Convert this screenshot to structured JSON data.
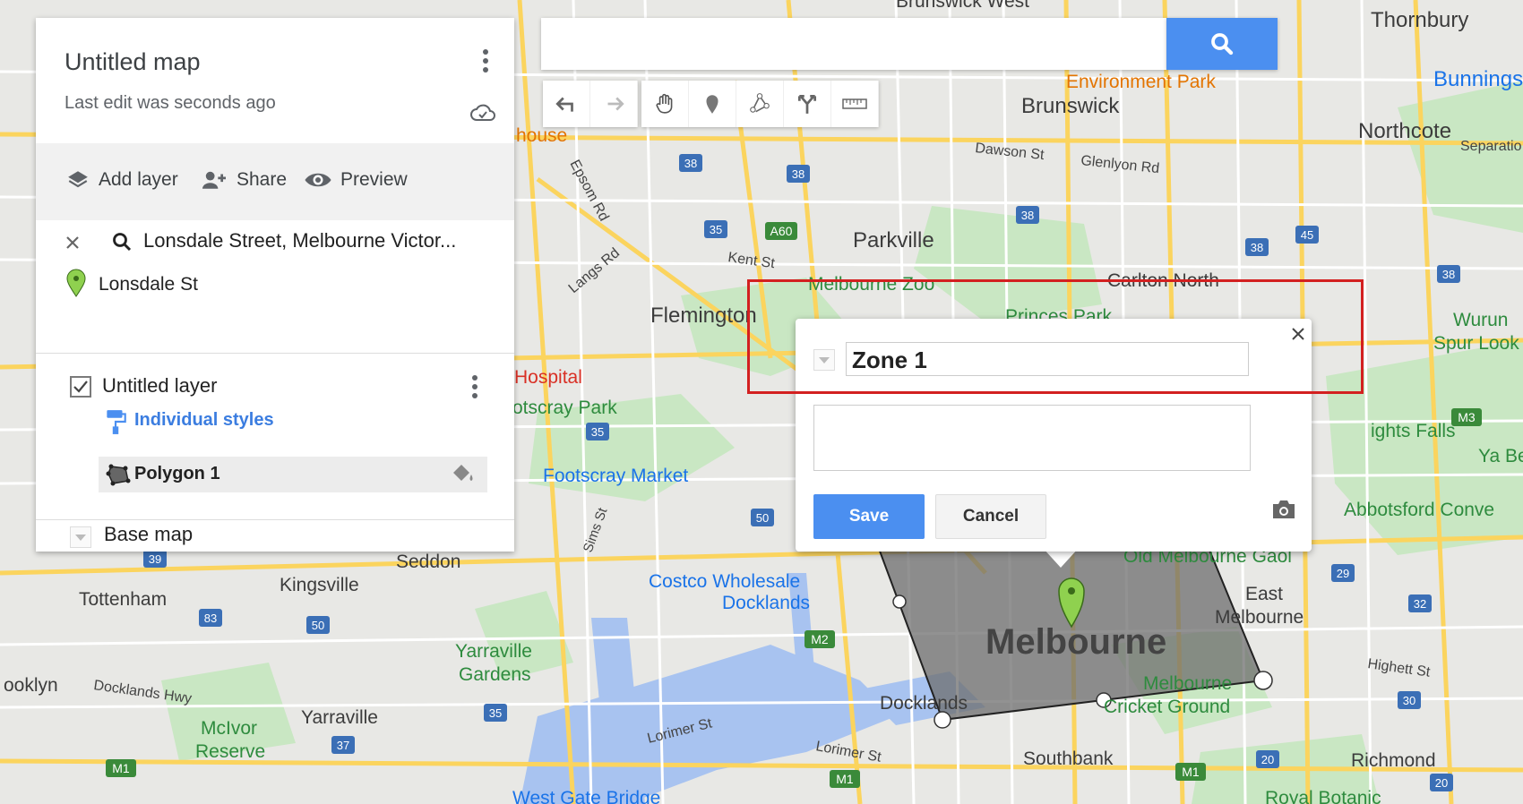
{
  "map_labels": {
    "brunswick_west": "Brunswick West",
    "thornbury": "Thornbury",
    "bunnings": "Bunnings",
    "environment_park": "Environment Park",
    "brunswick": "Brunswick",
    "northcote": "Northcote",
    "separation": "Separatio",
    "dawson_st": "Dawson St",
    "glenlyon_rd": "Glenlyon Rd",
    "house": "house",
    "epsom_rd": "Epsom Rd",
    "parkville": "Parkville",
    "kent_st": "Kent St",
    "a60": "A60",
    "carlton_north": "Carlton North",
    "melbourne_zoo": "Melbourne Zoo",
    "langs_rd": "Langs Rd",
    "flemington": "Flemington",
    "princes_park": "Princes Park",
    "wurundjeri": "Wurun",
    "spur_lookout": "Spur Look",
    "hospital": "Hospital",
    "footscray_park": "otscray Park",
    "heights_falls": "ights Falls",
    "m3": "M3",
    "footscray_market": "Footscray Market",
    "yarra_bend": "Ya Bend",
    "abbotsford": "Abbotsford Conve",
    "sims_st": "Sims St",
    "seddon": "Seddon",
    "kingsville": "Kingsville",
    "tottenham": "Tottenham",
    "costco": "Costco Wholesale",
    "docklands_costco": "Docklands",
    "old_melbourne_gaol": "Old Melbourne Gaol",
    "east_melbourne_1": "East",
    "east_melbourne_2": "Melbourne",
    "melbourne": "Melbourne",
    "m2": "M2",
    "brooklyn": "ooklyn",
    "docklands_hwy": "Docklands Hwy",
    "yarraville_gardens_1": "Yarraville",
    "yarraville_gardens_2": "Gardens",
    "highett_st": "Highett St",
    "mcg_1": "Melbourne",
    "mcg_2": "Cricket Ground",
    "docklands": "Docklands",
    "mcivor_1": "McIvor",
    "mcivor_2": "Reserve",
    "yarraville": "Yarraville",
    "lorimer_st": "Lorimer St",
    "lorimer_st2": "Lorimer St",
    "southbank": "Southbank",
    "richmond": "Richmond",
    "west_gate_bridge": "West Gate Bridge",
    "royal_botanic": "Royal Botanic",
    "m1": "M1",
    "r_38a": "38",
    "r_38b": "38",
    "r_38c": "38",
    "r_38d": "38",
    "r_38e": "38",
    "r_35": "35",
    "r_35b": "35",
    "r_45": "45",
    "r_50": "50",
    "r_50b": "50",
    "r_39": "39",
    "r_83": "83",
    "r_37": "37",
    "r_29": "29",
    "r_32": "32",
    "r_30": "30",
    "r_20": "20",
    "r_20b": "20",
    "r_m1b": "M1",
    "r_m1c": "M1"
  },
  "panel": {
    "title": "Untitled map",
    "subtitle": "Last edit was seconds ago",
    "add_layer": "Add layer",
    "share": "Share",
    "preview": "Preview",
    "search_query": "Lonsdale Street, Melbourne Victor...",
    "search_result": "Lonsdale St",
    "layer_name": "Untitled layer",
    "layer_style": "Individual styles",
    "feature_name": "Polygon 1",
    "base_map": "Base map"
  },
  "search": {
    "value": ""
  },
  "popup": {
    "title_value": "Zone 1",
    "description_value": "",
    "save": "Save",
    "cancel": "Cancel"
  },
  "colors": {
    "accent": "#4b8ff0",
    "highlight": "#d32020",
    "marker": "#8fd14f",
    "polygon_fill": "#6e6e6e"
  },
  "icons": [
    "search-icon",
    "undo-icon",
    "redo-icon",
    "hand-icon",
    "marker-icon",
    "line-icon",
    "route-icon",
    "ruler-icon",
    "close-icon",
    "camera-icon",
    "cloud-check-icon",
    "layers-icon",
    "add-person-icon",
    "eye-icon",
    "paint-roller-icon",
    "paint-bucket-icon",
    "polygon-icon",
    "kebab-menu-icon"
  ]
}
